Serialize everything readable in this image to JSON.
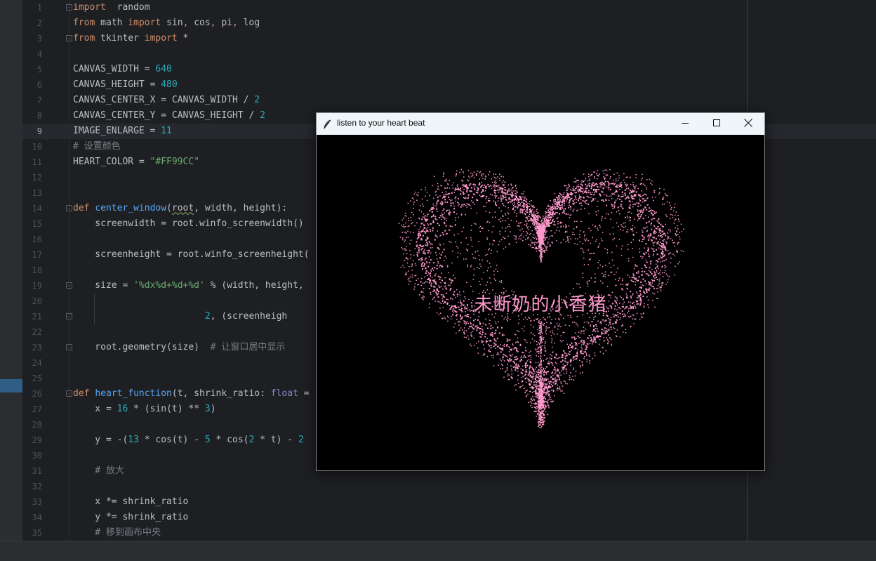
{
  "editor": {
    "lines": [
      {
        "n": "1",
        "fold": true,
        "segs": [
          [
            "kw",
            "import"
          ],
          [
            "",
            "  random"
          ]
        ]
      },
      {
        "n": "2",
        "fold": false,
        "segs": [
          [
            "kw",
            "from"
          ],
          [
            "",
            " math "
          ],
          [
            "kw",
            "import"
          ],
          [
            "",
            " sin"
          ],
          [
            "kw",
            ","
          ],
          [
            "",
            " cos"
          ],
          [
            "kw",
            ","
          ],
          [
            "",
            " pi"
          ],
          [
            "kw",
            ","
          ],
          [
            "",
            " log"
          ]
        ]
      },
      {
        "n": "3",
        "fold": true,
        "segs": [
          [
            "kw",
            "from"
          ],
          [
            "",
            " tkinter "
          ],
          [
            "kw",
            "import"
          ],
          [
            "",
            " *"
          ]
        ]
      },
      {
        "n": "4",
        "fold": false,
        "segs": []
      },
      {
        "n": "5",
        "fold": false,
        "segs": [
          [
            "",
            "CANVAS_WIDTH = "
          ],
          [
            "num",
            "640"
          ]
        ]
      },
      {
        "n": "6",
        "fold": false,
        "segs": [
          [
            "",
            "CANVAS_HEIGHT = "
          ],
          [
            "num",
            "480"
          ]
        ]
      },
      {
        "n": "7",
        "fold": false,
        "segs": [
          [
            "",
            "CANVAS_CENTER_X = CANVAS_WIDTH / "
          ],
          [
            "num",
            "2"
          ]
        ]
      },
      {
        "n": "8",
        "fold": false,
        "segs": [
          [
            "",
            "CANVAS_CENTER_Y = CANVAS_HEIGHT / "
          ],
          [
            "num",
            "2"
          ]
        ]
      },
      {
        "n": "9",
        "fold": false,
        "segs": [
          [
            "",
            "IMAGE_ENLARGE = "
          ],
          [
            "num",
            "11"
          ]
        ]
      },
      {
        "n": "10",
        "fold": false,
        "segs": [
          [
            "cm",
            "# 设置颜色"
          ]
        ]
      },
      {
        "n": "11",
        "fold": false,
        "segs": [
          [
            "",
            "HEART_COLOR = "
          ],
          [
            "str",
            "\"#FF99CC\""
          ]
        ]
      },
      {
        "n": "12",
        "fold": false,
        "segs": []
      },
      {
        "n": "13",
        "fold": false,
        "segs": []
      },
      {
        "n": "14",
        "fold": true,
        "segs": [
          [
            "kw",
            "def "
          ],
          [
            "fn",
            "center_window"
          ],
          [
            "",
            "("
          ],
          [
            "wavy",
            "root"
          ],
          [
            "",
            ", width, height):"
          ]
        ]
      },
      {
        "n": "15",
        "fold": false,
        "segs": [
          [
            "",
            "    screenwidth = root.winfo_screenwidth()"
          ]
        ]
      },
      {
        "n": "16",
        "fold": false,
        "segs": []
      },
      {
        "n": "17",
        "fold": false,
        "segs": [
          [
            "",
            "    screenheight = root.winfo_screenheight("
          ]
        ]
      },
      {
        "n": "18",
        "fold": false,
        "segs": []
      },
      {
        "n": "19",
        "fold": true,
        "segs": [
          [
            "",
            "    size = "
          ],
          [
            "str",
            "'%dx%d+%d+%d'"
          ],
          [
            "",
            " % (width, height,"
          ]
        ]
      },
      {
        "n": "20",
        "fold": false,
        "segs": []
      },
      {
        "n": "21",
        "fold": true,
        "segs": [
          [
            "",
            "                        "
          ],
          [
            "num",
            "2"
          ],
          [
            "",
            ", (screenheigh"
          ]
        ]
      },
      {
        "n": "22",
        "fold": false,
        "segs": []
      },
      {
        "n": "23",
        "fold": true,
        "segs": [
          [
            "",
            "    root.geometry(size)  "
          ],
          [
            "cm",
            "# 让窗口居中显示"
          ]
        ]
      },
      {
        "n": "24",
        "fold": false,
        "segs": []
      },
      {
        "n": "25",
        "fold": false,
        "segs": []
      },
      {
        "n": "26",
        "fold": true,
        "segs": [
          [
            "kw",
            "def "
          ],
          [
            "fn",
            "heart_function"
          ],
          [
            "",
            "(t, shrink_ratio: "
          ],
          [
            "ty",
            "float"
          ],
          [
            "",
            " ="
          ]
        ]
      },
      {
        "n": "27",
        "fold": false,
        "segs": [
          [
            "",
            "    x = "
          ],
          [
            "num",
            "16"
          ],
          [
            "",
            " * (sin(t) ** "
          ],
          [
            "num",
            "3"
          ],
          [
            "",
            ")"
          ]
        ]
      },
      {
        "n": "28",
        "fold": false,
        "segs": []
      },
      {
        "n": "29",
        "fold": false,
        "segs": [
          [
            "",
            "    y = -("
          ],
          [
            "num",
            "13"
          ],
          [
            "",
            " * cos(t) - "
          ],
          [
            "num",
            "5"
          ],
          [
            "",
            " * cos("
          ],
          [
            "num",
            "2"
          ],
          [
            "",
            " * t) - "
          ],
          [
            "num",
            "2"
          ]
        ]
      },
      {
        "n": "30",
        "fold": false,
        "segs": []
      },
      {
        "n": "31",
        "fold": false,
        "segs": [
          [
            "cm",
            "    # 放大"
          ]
        ]
      },
      {
        "n": "32",
        "fold": false,
        "segs": []
      },
      {
        "n": "33",
        "fold": false,
        "segs": [
          [
            "",
            "    x *= shrink_ratio"
          ]
        ]
      },
      {
        "n": "34",
        "fold": false,
        "segs": [
          [
            "",
            "    y *= shrink_ratio"
          ]
        ]
      },
      {
        "n": "35",
        "fold": false,
        "segs": [
          [
            "cm",
            "    # 移到画布中央"
          ]
        ]
      }
    ]
  },
  "tk_window": {
    "title": "listen to your heart beat",
    "minimize_icon": "minimize-icon",
    "maximize_icon": "maximize-icon",
    "close_icon": "close-icon",
    "app_icon": "feather-icon",
    "heart_text": "未断奶的小香猪",
    "heart_color": "#FF99CC"
  }
}
